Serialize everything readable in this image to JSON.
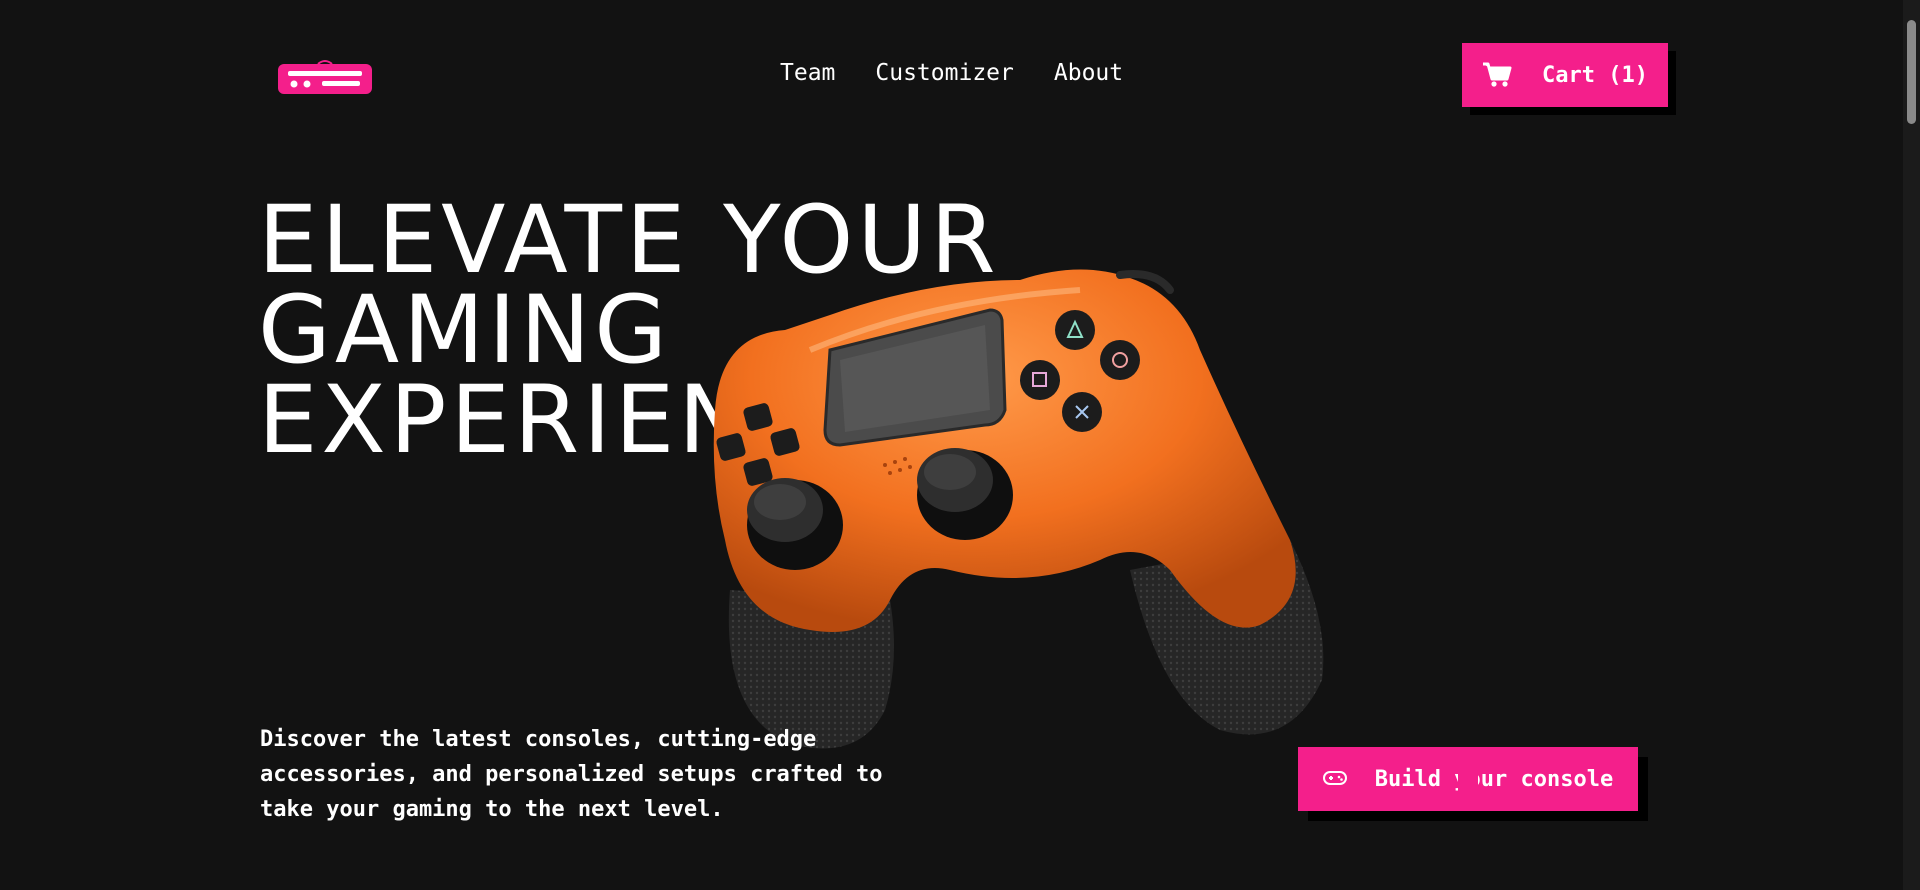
{
  "header": {
    "logo_name": "console-logo-icon",
    "nav": [
      {
        "label": "Team"
      },
      {
        "label": "Customizer"
      },
      {
        "label": "About"
      }
    ],
    "cart_label": "Cart (1)",
    "cart_icon": "shopping-cart-icon"
  },
  "hero": {
    "headline_lines": [
      "ELEVATE YOUR",
      "GAMING",
      "EXPERIENCE"
    ],
    "description": "Discover the latest consoles, cutting-edge accessories, and personalized setups crafted to take your gaming to the next level.",
    "cta_label": "Build your console",
    "cta_icon": "gamepad-icon"
  },
  "colors": {
    "background": "#121212",
    "accent": "#f41f8b",
    "controller": "#f2701f",
    "shadow": "#000000",
    "text": "#ffffff"
  }
}
